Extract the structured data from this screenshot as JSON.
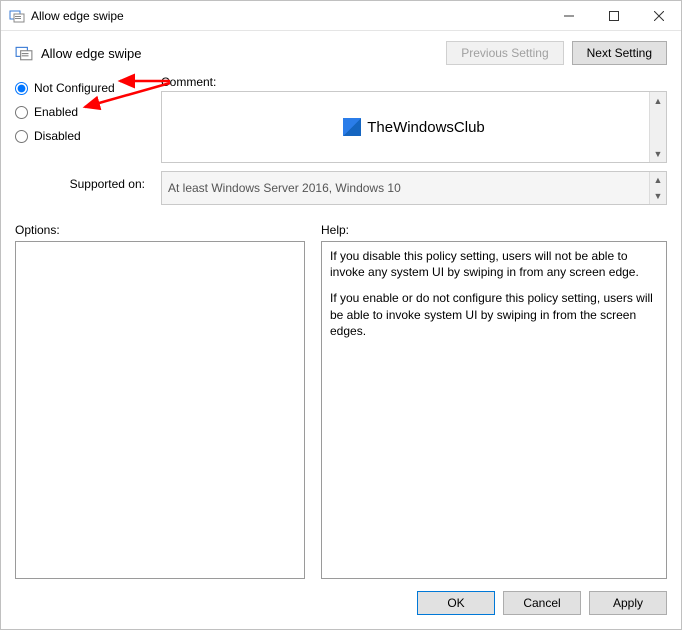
{
  "window": {
    "title": "Allow edge swipe"
  },
  "header": {
    "title": "Allow edge swipe",
    "prev_label": "Previous Setting",
    "next_label": "Next Setting"
  },
  "radios": {
    "not_configured": "Not Configured",
    "enabled": "Enabled",
    "disabled": "Disabled",
    "selected": "not_configured"
  },
  "comment": {
    "label": "Comment:",
    "logo_text": "TheWindowsClub"
  },
  "supported": {
    "label": "Supported on:",
    "value": "At least Windows Server 2016, Windows 10"
  },
  "options": {
    "label": "Options:"
  },
  "help": {
    "label": "Help:",
    "p1": "If you disable this policy setting, users will not be able to invoke any system UI by swiping in from any screen edge.",
    "p2": "If you enable or do not configure this policy setting, users will be able to invoke system UI by swiping in from the screen edges."
  },
  "footer": {
    "ok": "OK",
    "cancel": "Cancel",
    "apply": "Apply"
  }
}
